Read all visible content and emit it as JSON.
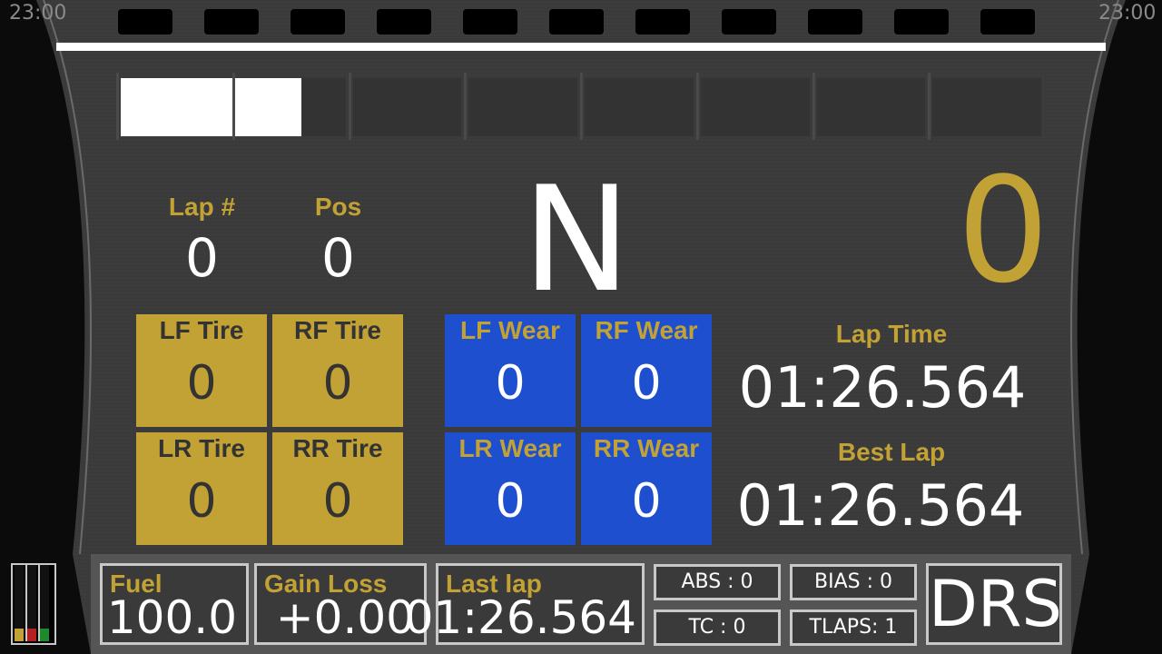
{
  "clock_left": "23:00",
  "clock_right": "23:00",
  "rpm": {
    "segments": 8,
    "lit_fraction": 0.2
  },
  "lap_number": {
    "label": "Lap #",
    "value": "0"
  },
  "position": {
    "label": "Pos",
    "value": "0"
  },
  "gear": "N",
  "speed": "0",
  "tires": [
    {
      "label": "LF Tire",
      "value": "0"
    },
    {
      "label": "RF Tire",
      "value": "0"
    },
    {
      "label": "LR Tire",
      "value": "0"
    },
    {
      "label": "RR Tire",
      "value": "0"
    }
  ],
  "wear": [
    {
      "label": "LF Wear",
      "value": "0"
    },
    {
      "label": "RF Wear",
      "value": "0"
    },
    {
      "label": "LR Wear",
      "value": "0"
    },
    {
      "label": "RR Wear",
      "value": "0"
    }
  ],
  "lap_time": {
    "label": "Lap Time",
    "value": "01:26.564"
  },
  "best_lap": {
    "label": "Best Lap",
    "value": "01:26.564"
  },
  "fuel": {
    "label": "Fuel",
    "value": "100.0"
  },
  "gain_loss": {
    "label": "Gain Loss",
    "value": "+0.00"
  },
  "last_lap": {
    "label": "Last lap",
    "value": "01:26.564"
  },
  "abs": "ABS : 0",
  "bias": "BIAS : 0",
  "tc": "TC : 0",
  "tlaps": "TLAPS: 1",
  "drs": "DRS",
  "colors": {
    "gold": "#c3a235",
    "blue": "#1e4fcf",
    "panel": "#3a3a3a"
  }
}
